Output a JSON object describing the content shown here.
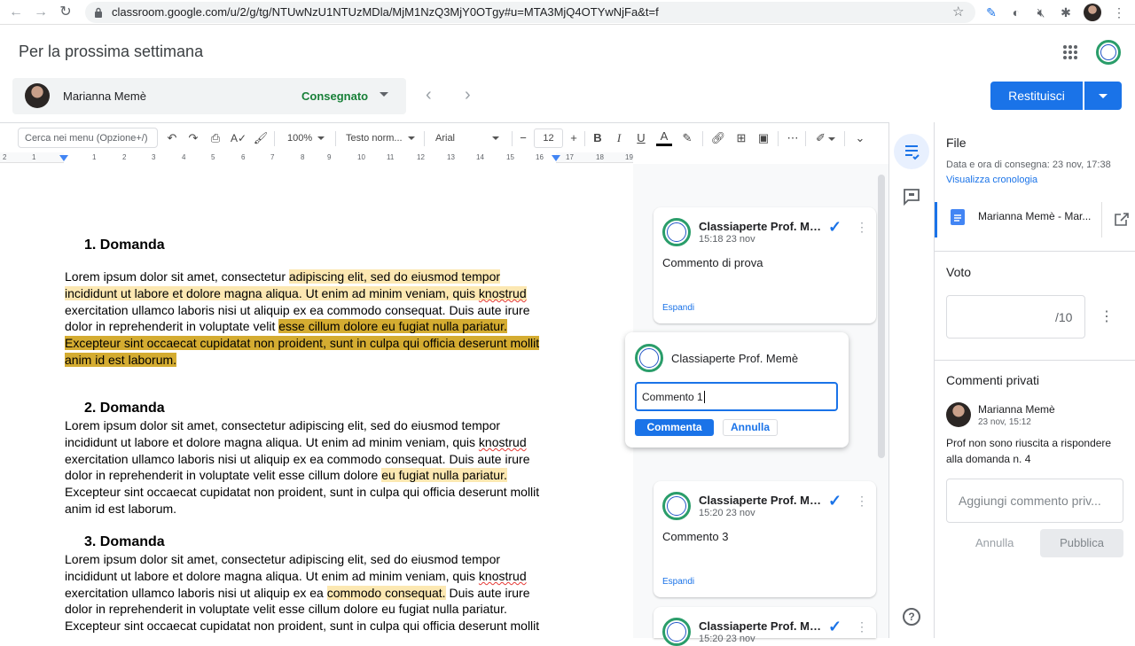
{
  "browser": {
    "url": "classroom.google.com/u/2/g/tg/NTUwNzU1NTUzMDla/MjM1NzQ3MjY0OTgy#u=MTA3MjQ4OTYwNjFa&t=f"
  },
  "header": {
    "title": "Per la prossima settimana"
  },
  "student_bar": {
    "name": "Marianna Memè",
    "status": "Consegnato"
  },
  "actions": {
    "return_label": "Restituisci"
  },
  "toolbar": {
    "search_placeholder": "Cerca nei menu (Opzione+/)",
    "zoom": "100%",
    "style": "Testo norm...",
    "font": "Arial",
    "font_size": "12"
  },
  "ruler": {
    "numbers": [
      "2",
      "1",
      "1",
      "2",
      "3",
      "4",
      "5",
      "6",
      "7",
      "8",
      "9",
      "10",
      "11",
      "12",
      "13",
      "14",
      "15",
      "16",
      "17",
      "18",
      "19"
    ]
  },
  "document": {
    "q1": "1.  Domanda",
    "q2": "2.  Domanda",
    "q3": "3.  Domanda",
    "p1": {
      "a": "Lorem ipsum dolor sit amet, consectetur ",
      "b": "adipiscing elit, sed do eiusmod tempor incididunt ut labore et dolore magna aliqua. Ut enim ad minim veniam, quis ",
      "c": "knostrud",
      "d": " exercitation ullamco laboris nisi ut aliquip ex ea commodo consequat. Duis aute irure dolor in reprehenderit in voluptate velit ",
      "e": "esse cillum dolore eu fugiat nulla pariatur. Excepteur sint occaecat cupidatat non proident, sunt in culpa qui officia deserunt mollit anim id est laborum."
    },
    "p2": {
      "a": "Lorem ipsum dolor sit amet, consectetur adipiscing elit, sed do eiusmod tempor incididunt ut labore et dolore magna aliqua. Ut enim ad minim veniam, quis ",
      "b": "knostrud",
      "c": " exercitation ullamco laboris nisi ut aliquip ex ea commodo consequat. Duis aute irure dolor in reprehenderit in voluptate velit esse cillum dolore ",
      "d": "eu fugiat nulla pariatur.",
      "e": " Excepteur sint occaecat cupidatat non proident, sunt in culpa qui officia deserunt mollit anim id est laborum."
    },
    "p3": {
      "a": "Lorem ipsum dolor sit amet, consectetur adipiscing elit, sed do eiusmod tempor incididunt ut labore et dolore magna aliqua. Ut enim ad minim veniam, quis ",
      "b": "knostrud",
      "c": " exercitation ullamco laboris nisi ut aliquip ex ea ",
      "d": "commodo consequat.",
      "e": " Duis aute irure dolor in reprehenderit in voluptate velit esse cillum dolore eu fugiat nulla pariatur. Excepteur sint occaecat cupidatat non proident, sunt in culpa qui officia deserunt mollit"
    }
  },
  "comments": [
    {
      "author": "Classiaperte Prof. Memè",
      "time": "15:18 23 nov",
      "text": "Commento di prova",
      "expand": "Espandi"
    },
    {
      "author": "Classiaperte Prof. Memè",
      "time": "15:20 23 nov",
      "text": "Commento 3",
      "expand": "Espandi"
    },
    {
      "author": "Classiaperte Prof. Memè",
      "time": "15:20 23 nov"
    }
  ],
  "new_comment": {
    "author": "Classiaperte Prof. Memè",
    "value": "Commento 1",
    "send_label": "Commenta",
    "cancel_label": "Annulla"
  },
  "panel": {
    "file_title": "File",
    "submission_date": "Data e ora di consegna: 23 nov, 17:38",
    "history_link": "Visualizza cronologia",
    "file_name": "Marianna Memè - Mar...",
    "grade_title": "Voto",
    "grade_max": "/10",
    "private_title": "Commenti privati",
    "private_author": "Marianna Memè",
    "private_time": "23 nov, 15:12",
    "private_text": "Prof non sono riuscita a rispondere alla domanda n. 4",
    "private_placeholder": "Aggiungi commento priv...",
    "cancel_label": "Annulla",
    "publish_label": "Pubblica"
  }
}
